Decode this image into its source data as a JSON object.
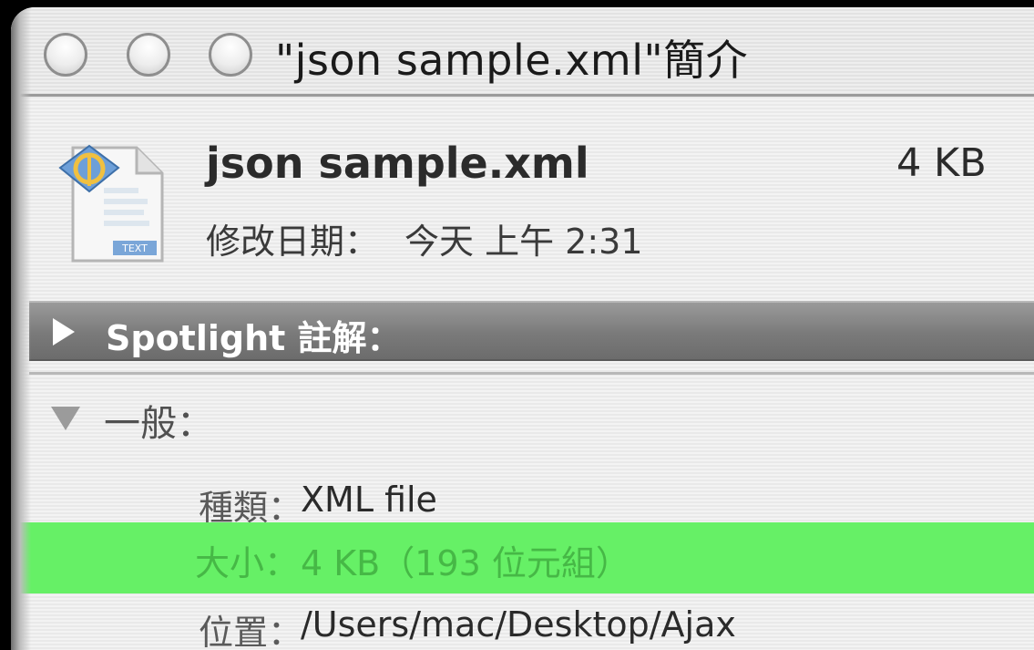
{
  "window": {
    "title": "\"json sample.xml\"簡介"
  },
  "file": {
    "name": "json sample.xml",
    "size": "4 KB",
    "modified_label": "修改日期：",
    "modified_value": "今天 上午 2:31",
    "icon": "xml-document-icon"
  },
  "spotlight": {
    "label": "Spotlight 註解：",
    "icon": "disclosure-right-icon"
  },
  "general": {
    "label": "一般：",
    "icon": "disclosure-down-icon",
    "rows": [
      {
        "key": "種類：",
        "value": "XML file"
      },
      {
        "key": "大小：",
        "value": "4 KB（193 位元組）"
      },
      {
        "key": "位置：",
        "value": "/Users/mac/Desktop/Ajax"
      }
    ]
  },
  "colors": {
    "highlight": "#66f066",
    "highlight_text": "#46b846",
    "section_bar": "#7a7a7a"
  }
}
